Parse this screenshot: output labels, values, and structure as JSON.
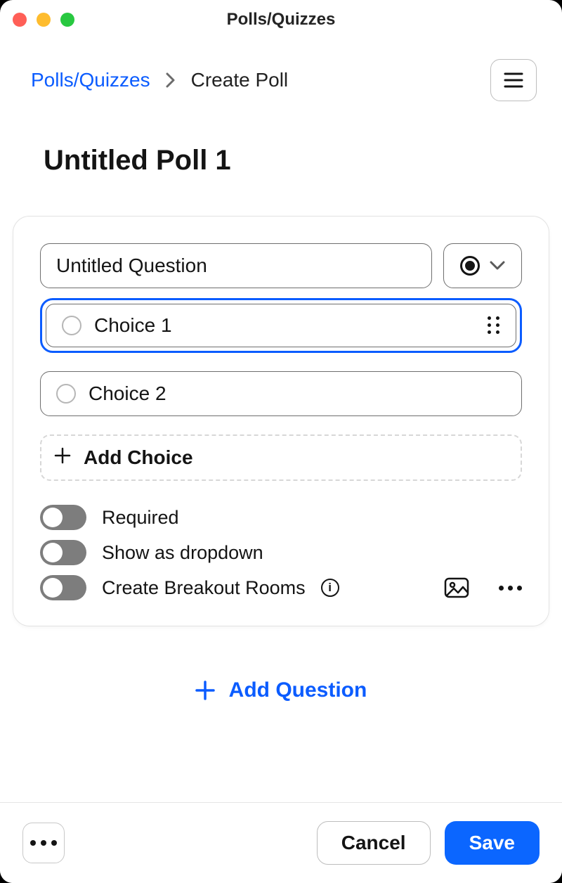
{
  "window": {
    "title": "Polls/Quizzes"
  },
  "breadcrumbs": {
    "root": "Polls/Quizzes",
    "current": "Create Poll"
  },
  "poll": {
    "title": "Untitled Poll 1"
  },
  "question": {
    "title": "Untitled Question",
    "type_icon": "single-choice",
    "choices": [
      {
        "label": "Choice 1",
        "active": true
      },
      {
        "label": "Choice 2",
        "active": false
      }
    ],
    "add_choice_label": "Add Choice",
    "toggles": {
      "required": {
        "label": "Required",
        "on": false
      },
      "dropdown": {
        "label": "Show as dropdown",
        "on": false
      },
      "breakout": {
        "label": "Create Breakout Rooms",
        "on": false
      }
    }
  },
  "add_question_label": "Add Question",
  "footer": {
    "cancel": "Cancel",
    "save": "Save"
  }
}
